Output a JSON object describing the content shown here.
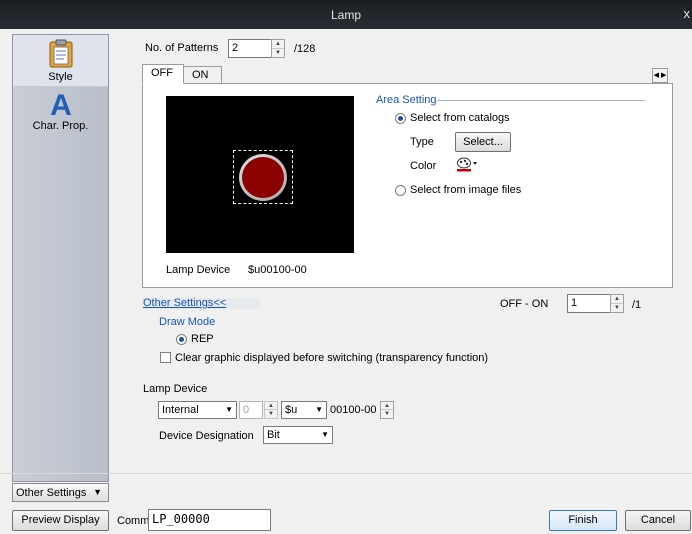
{
  "window": {
    "title": "Lamp",
    "close_glyph": "x"
  },
  "sidebar": {
    "items": [
      {
        "label": "Style",
        "icon": "clipboard-icon"
      },
      {
        "label": "Char. Prop.",
        "icon": "char-a-icon"
      }
    ],
    "other_settings_label": "Other Settings"
  },
  "patterns": {
    "label": "No. of Patterns",
    "value": "2",
    "max": "/128"
  },
  "tabs": [
    {
      "label": "OFF"
    },
    {
      "label": "ON"
    }
  ],
  "area_setting": {
    "title": "Area Setting",
    "option_catalogs": "Select from catalogs",
    "type_label": "Type",
    "select_button": "Select...",
    "color_label": "Color",
    "option_image_files": "Select from image files"
  },
  "preview": {
    "lamp_device_label": "Lamp Device",
    "lamp_device_value": "$u00100-00",
    "lamp_color": "#8b0000"
  },
  "other_settings": {
    "link": "Other Settings<<",
    "off_on_label": "OFF - ON",
    "off_on_value": "1",
    "off_on_max": "/1",
    "draw_mode_label": "Draw Mode",
    "draw_mode_option": "REP",
    "clear_graphic_label": "Clear graphic displayed before switching (transparency function)"
  },
  "lamp_device": {
    "section_label": "Lamp Device",
    "type_value": "Internal",
    "number_value": "0",
    "device_value": "$u",
    "address_value": "00100-00",
    "designation_label": "Device Designation",
    "designation_value": "Bit"
  },
  "footer": {
    "preview_button": "Preview Display",
    "comment_label": "Comme",
    "comment_value": "LP_00000",
    "finish_button": "Finish",
    "cancel_button": "Cancel"
  }
}
